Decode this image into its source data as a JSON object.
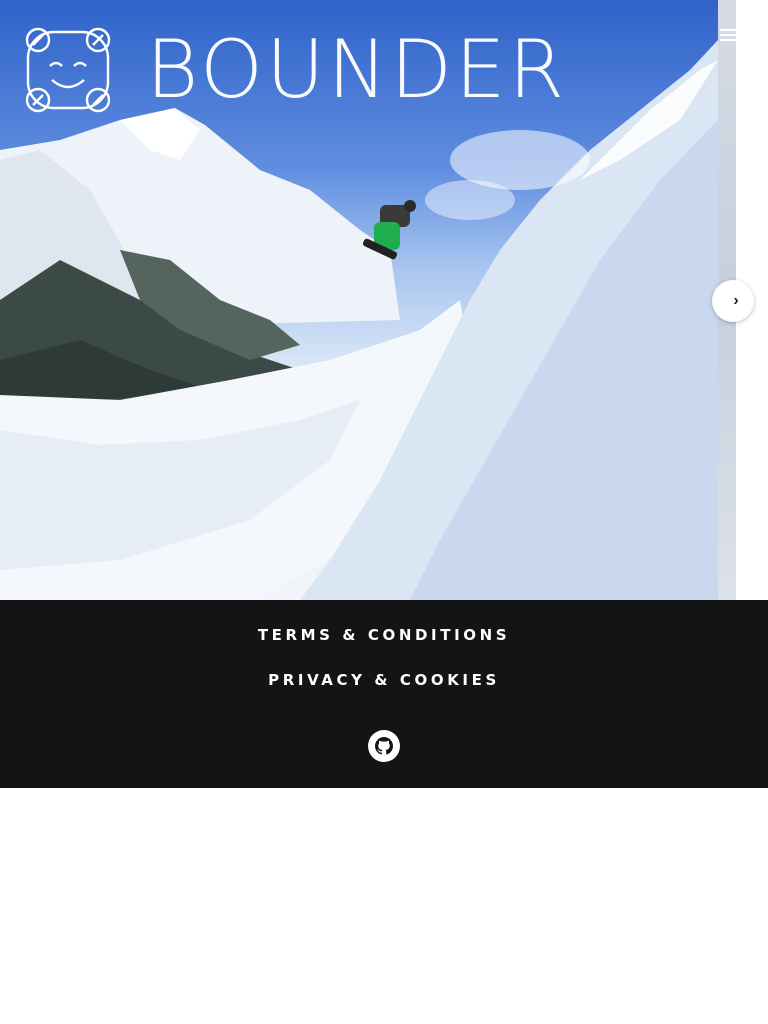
{
  "brand": {
    "name": "BOUNDER",
    "logo_icon": "smiling-bear-face-logo"
  },
  "header": {
    "menu_icon": "hamburger-menu-icon"
  },
  "carousel": {
    "next_icon": "chevron-right-icon",
    "next_glyph": "›"
  },
  "footer": {
    "terms_label": "TERMS & CONDITIONS",
    "privacy_label": "PRIVACY & COOKIES",
    "github_icon": "github-icon"
  },
  "colors": {
    "footer_bg": "#141414",
    "text_light": "#ffffff",
    "sky_top": "#2f63c9"
  }
}
